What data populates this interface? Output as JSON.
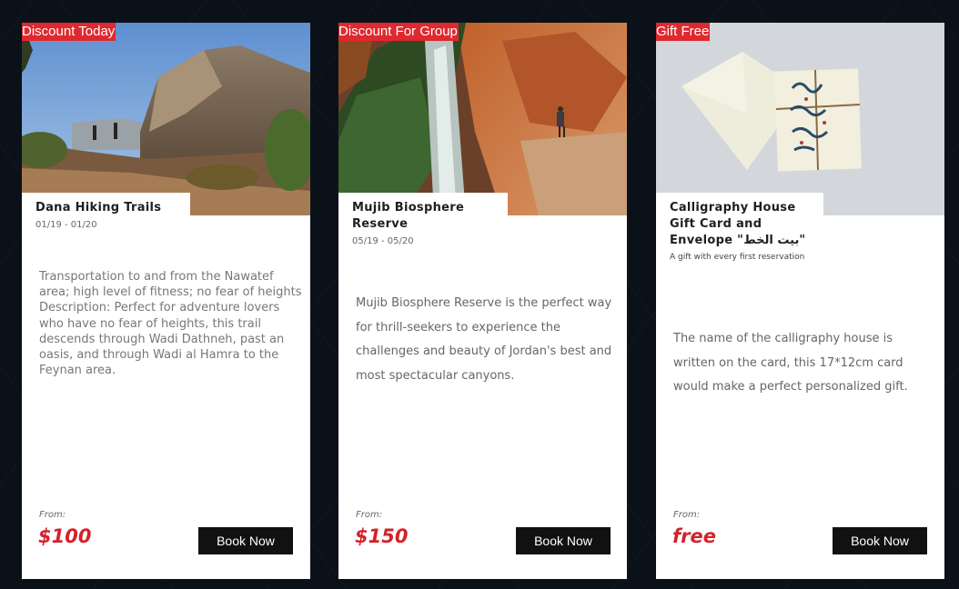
{
  "cards": [
    {
      "tag": "Discount Today",
      "image": "mountain-hiking-trail",
      "title": "Dana Hiking Trails",
      "dates": "01/19 - 01/20",
      "description": "Transportation to and from the Nawatef area; high level of fitness; no fear of heights Description: Perfect for adventure lovers who have no fear of heights, this trail descends through Wadi Dathneh, past an oasis, and through Wadi al Hamra to the Feynan area.",
      "from_label": "From:",
      "price": "$100",
      "button": "Book Now"
    },
    {
      "tag": "Discount For Group",
      "image": "canyon-waterfall-climber",
      "title": "Mujib Biosphere Reserve",
      "dates": "05/19 - 05/20",
      "description": "Mujib Biosphere Reserve is the perfect way for thrill-seekers to experience the challenges and beauty of Jordan's best and most spectacular canyons.",
      "from_label": "From:",
      "price": "$150",
      "button": "Book Now"
    },
    {
      "tag": "Gift Free",
      "image": "calligraphy-gift-card-envelope",
      "title": "Calligraphy House Gift Card and Envelope \"بيت الخط\"",
      "dates": "A gift with every first reservation",
      "description": "The name of the calligraphy house is written on the card, this 17*12cm card would make a perfect personalized gift.",
      "from_label": "From:",
      "price": "free",
      "button": "Book Now"
    }
  ],
  "colors": {
    "background": "#0b1118",
    "tag": "#e0282f",
    "price": "#d2232a",
    "button": "#111111"
  }
}
